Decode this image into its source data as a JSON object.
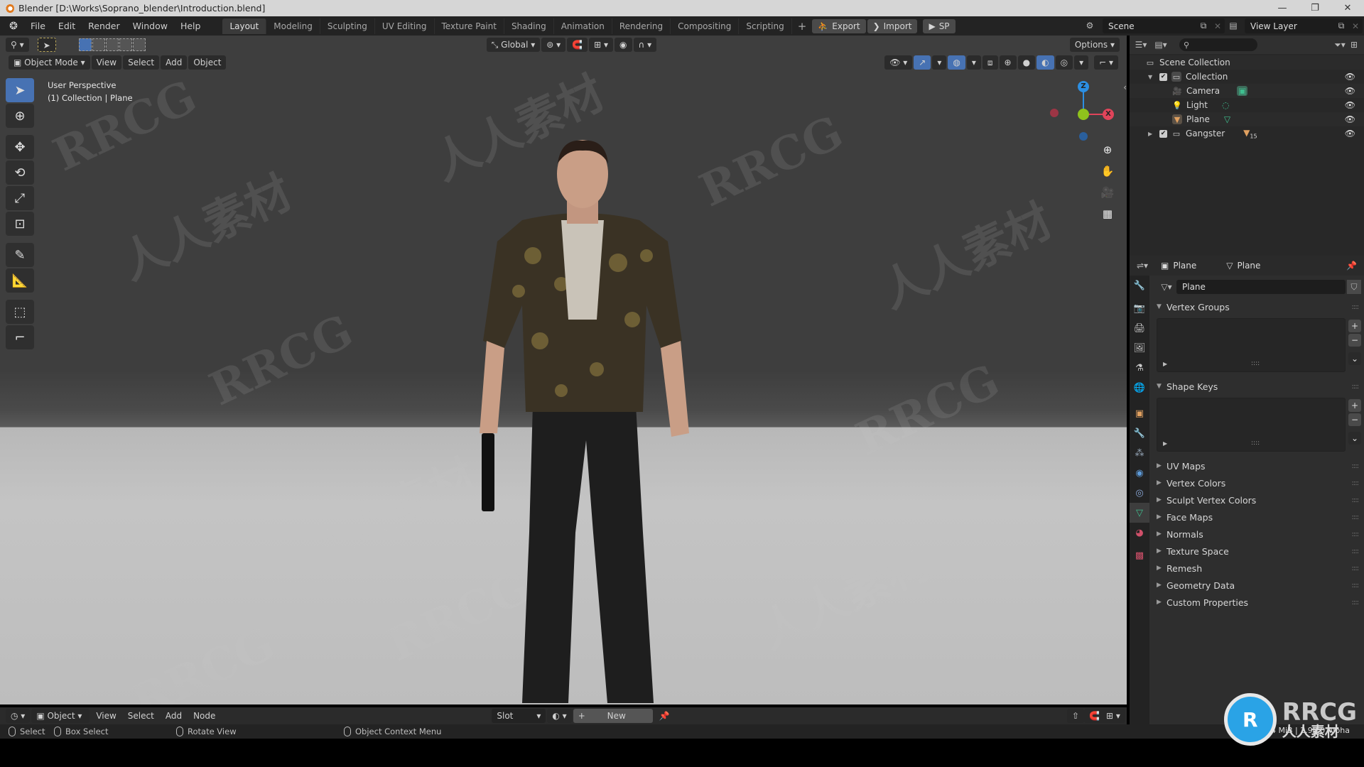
{
  "window": {
    "title": "Blender [D:\\Works\\Soprano_blender\\Introduction.blend]",
    "minimize_icon": "minimize-icon",
    "maximize_icon": "restore-icon",
    "close_icon": "close-icon"
  },
  "menu": {
    "items": [
      "File",
      "Edit",
      "Render",
      "Window",
      "Help"
    ]
  },
  "workspaces": {
    "tabs": [
      "Layout",
      "Modeling",
      "Sculpting",
      "UV Editing",
      "Texture Paint",
      "Shading",
      "Animation",
      "Rendering",
      "Compositing",
      "Scripting"
    ],
    "active": "Layout",
    "add_label": "+"
  },
  "addon_buttons": {
    "export": "Export",
    "import": "Import",
    "sp": "SP"
  },
  "scene": {
    "name": "Scene",
    "view_layer": "View Layer"
  },
  "viewport": {
    "mode": "Object Mode",
    "menus": [
      "View",
      "Select",
      "Add",
      "Object"
    ],
    "transform_orientation": "Global",
    "options_label": "Options",
    "overlay_line1": "User Perspective",
    "overlay_line2": "(1) Collection | Plane",
    "gizmo": {
      "x": "X",
      "y": "Y",
      "z": "Z",
      "colors": {
        "x": "#e0445a",
        "y": "#8fc21c",
        "z": "#2c8fe3"
      }
    }
  },
  "toolbar": {
    "tools": [
      "select-box",
      "cursor",
      "move",
      "rotate",
      "scale",
      "transform",
      "annotate",
      "measure",
      "add-cube",
      "extrude"
    ],
    "active": "select-box"
  },
  "shader_header": {
    "editor": "Object",
    "menus": [
      "View",
      "Select",
      "Add",
      "Node"
    ],
    "slot": "Slot",
    "new_label": "New"
  },
  "statusbar": {
    "select": "Select",
    "box_select": "Box Select",
    "rotate_view": "Rotate View",
    "context_menu": "Object Context Menu",
    "memory": "Mem: 9.4 MiB | 2.90.0 Alpha"
  },
  "outliner": {
    "root": "Scene Collection",
    "rows": [
      {
        "name": "Collection",
        "type": "collection",
        "level": 1,
        "expanded": true,
        "checked": true
      },
      {
        "name": "Camera",
        "type": "camera",
        "level": 2
      },
      {
        "name": "Light",
        "type": "light",
        "level": 2
      },
      {
        "name": "Plane",
        "type": "mesh",
        "level": 2
      },
      {
        "name": "Gangster",
        "type": "collection",
        "level": 1,
        "expanded": false,
        "checked": true,
        "badge": "15"
      }
    ]
  },
  "properties": {
    "context_object": "Plane",
    "context_data": "Plane",
    "mesh_name": "Plane",
    "panels": [
      {
        "label": "Vertex Groups",
        "expanded": true
      },
      {
        "label": "Shape Keys",
        "expanded": true
      },
      {
        "label": "UV Maps",
        "expanded": false
      },
      {
        "label": "Vertex Colors",
        "expanded": false
      },
      {
        "label": "Sculpt Vertex Colors",
        "expanded": false
      },
      {
        "label": "Face Maps",
        "expanded": false
      },
      {
        "label": "Normals",
        "expanded": false
      },
      {
        "label": "Texture Space",
        "expanded": false
      },
      {
        "label": "Remesh",
        "expanded": false
      },
      {
        "label": "Geometry Data",
        "expanded": false
      },
      {
        "label": "Custom Properties",
        "expanded": false
      }
    ],
    "tabs": [
      "tool",
      "render",
      "output",
      "view-layer",
      "scene",
      "world",
      "object",
      "modifiers",
      "particles",
      "physics",
      "constraints",
      "data",
      "material",
      "texture"
    ],
    "active_tab": "data"
  },
  "watermark": {
    "text_en": "RRCG",
    "text_cn": "人人素材"
  }
}
